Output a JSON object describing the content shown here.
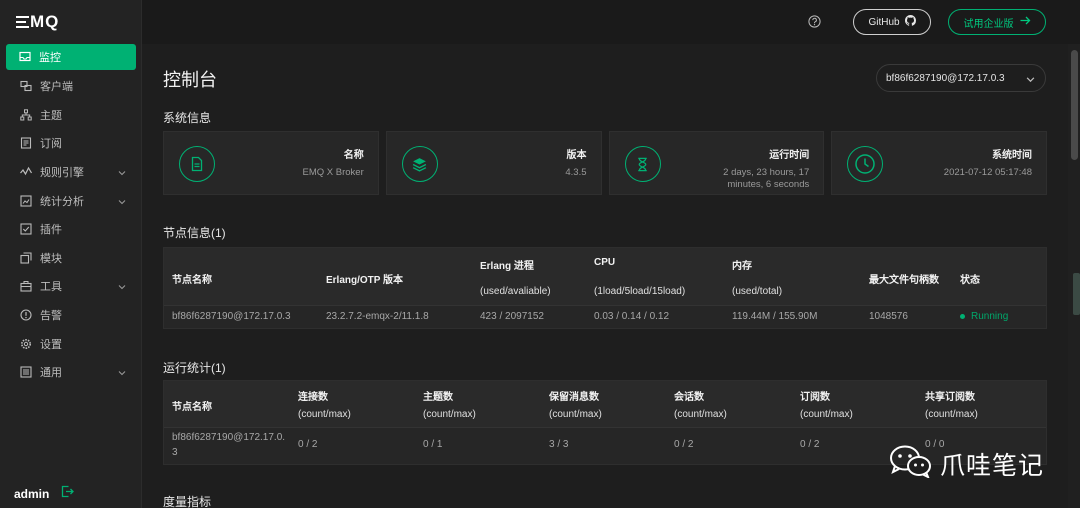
{
  "app": {
    "logo_text": "MQ"
  },
  "sidebar": {
    "items": [
      {
        "label": "监控",
        "icon": "monitor-icon",
        "active": true
      },
      {
        "label": "客户端",
        "icon": "clients-icon"
      },
      {
        "label": "主题",
        "icon": "topics-icon"
      },
      {
        "label": "订阅",
        "icon": "subscription-icon"
      },
      {
        "label": "规则引擎",
        "icon": "rule-engine-icon",
        "expandable": true
      },
      {
        "label": "统计分析",
        "icon": "analytics-icon",
        "expandable": true
      },
      {
        "label": "插件",
        "icon": "plugin-icon"
      },
      {
        "label": "模块",
        "icon": "module-icon"
      },
      {
        "label": "工具",
        "icon": "tools-icon",
        "expandable": true
      },
      {
        "label": "告警",
        "icon": "alarm-icon"
      },
      {
        "label": "设置",
        "icon": "settings-icon"
      },
      {
        "label": "通用",
        "icon": "general-icon",
        "expandable": true
      }
    ],
    "user": "admin"
  },
  "header": {
    "github_label": "GitHub",
    "trial_label": "试用企业版"
  },
  "main": {
    "title": "控制台",
    "node_select": "bf86f6287190@172.17.0.3",
    "system_info_title": "系统信息",
    "cards": [
      {
        "label": "名称",
        "value": "EMQ X Broker",
        "icon": "document-icon"
      },
      {
        "label": "版本",
        "value": "4.3.5",
        "icon": "layers-icon"
      },
      {
        "label": "运行时间",
        "value": "2 days, 23 hours, 17 minutes, 6 seconds",
        "icon": "hourglass-icon"
      },
      {
        "label": "系统时间",
        "value": "2021-07-12 05:17:48",
        "icon": "clock-icon"
      }
    ],
    "node_info_title": "节点信息(1)",
    "node_table": {
      "headers": {
        "name": "节点名称",
        "otp": "Erlang/OTP 版本",
        "proc": "Erlang 进程",
        "proc_sub": "(used/avaliable)",
        "cpu": "CPU",
        "cpu_sub": "(1load/5load/15load)",
        "mem": "内存",
        "mem_sub": "(used/total)",
        "fd": "最大文件句柄数",
        "status": "状态"
      },
      "row": {
        "name": "bf86f6287190@172.17.0.3",
        "otp": "23.2.7.2-emqx-2/11.1.8",
        "proc": "423 / 2097152",
        "cpu": "0.03 / 0.14 / 0.12",
        "mem": "119.44M / 155.90M",
        "fd": "1048576",
        "status": "Running"
      }
    },
    "stats_title": "运行统计(1)",
    "stats_table": {
      "headers": {
        "name": "节点名称",
        "conn": "连接数",
        "topics": "主题数",
        "retained": "保留消息数",
        "sessions": "会话数",
        "subs": "订阅数",
        "shared": "共享订阅数",
        "sub": "(count/max)"
      },
      "row": {
        "name_line1": "bf86f6287190@172.17.0.",
        "name_line2": "3",
        "conn": "0 / 2",
        "topics": "0 / 1",
        "retained": "3 / 3",
        "sessions": "0 / 2",
        "subs": "0 / 2",
        "shared": "0 / 0"
      }
    },
    "metrics_title": "度量指标"
  },
  "watermark": {
    "text": "爪哇笔记"
  }
}
